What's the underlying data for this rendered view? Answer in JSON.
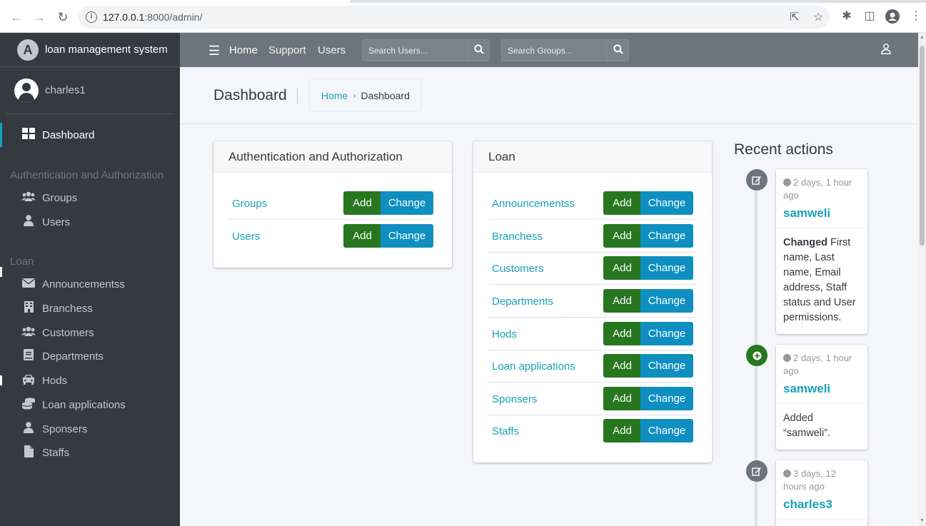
{
  "browser": {
    "url_host": "127.0.0.1",
    "url_rest": ":8000/admin/"
  },
  "brand": {
    "logo_letter": "A",
    "name": "loan management system"
  },
  "user": {
    "name": "charles1"
  },
  "sidebar": {
    "dashboard": "Dashboard",
    "auth_header": "Authentication and Authorization",
    "auth_items": [
      {
        "label": "Groups",
        "icon": "users-icon"
      },
      {
        "label": "Users",
        "icon": "user-icon"
      }
    ],
    "loan_header": "Loan",
    "loan_items": [
      {
        "label": "Announcementss",
        "icon": "envelope-icon"
      },
      {
        "label": "Branchess",
        "icon": "building-icon"
      },
      {
        "label": "Customers",
        "icon": "users-icon"
      },
      {
        "label": "Departments",
        "icon": "book-icon"
      },
      {
        "label": "Hods",
        "icon": "car-icon"
      },
      {
        "label": "Loan applications",
        "icon": "coins-icon"
      },
      {
        "label": "Sponsers",
        "icon": "user-icon"
      },
      {
        "label": "Staffs",
        "icon": "file-icon"
      }
    ]
  },
  "topbar": {
    "links": [
      "Home",
      "Support",
      "Users"
    ],
    "search_users_placeholder": "Search Users...",
    "search_groups_placeholder": "Search Groups..."
  },
  "header": {
    "title": "Dashboard",
    "breadcrumb_home": "Home",
    "breadcrumb_sep": "›",
    "breadcrumb_current": "Dashboard"
  },
  "buttons": {
    "add": "Add",
    "change": "Change"
  },
  "apps": [
    {
      "name": "Authentication and Authorization",
      "models": [
        "Groups",
        "Users"
      ]
    },
    {
      "name": "Loan",
      "models": [
        "Announcementss",
        "Branchess",
        "Customers",
        "Departments",
        "Hods",
        "Loan applications",
        "Sponsers",
        "Staffs"
      ]
    }
  ],
  "recent": {
    "title": "Recent actions",
    "actions": [
      {
        "type": "change",
        "color": "#6c757d",
        "time": "2 days, 1 hour ago",
        "object": "samweli",
        "verb": "Changed",
        "detail": " First name, Last name, Email address, Staff status and User permissions."
      },
      {
        "type": "add",
        "color": "#28761f",
        "time": "2 days, 1 hour ago",
        "object": "samweli",
        "verb": "",
        "detail": "Added “samweli”."
      },
      {
        "type": "change",
        "color": "#6c757d",
        "time": "3 days, 12 hours ago",
        "object": "charles3",
        "verb": "",
        "detail": ""
      }
    ]
  }
}
